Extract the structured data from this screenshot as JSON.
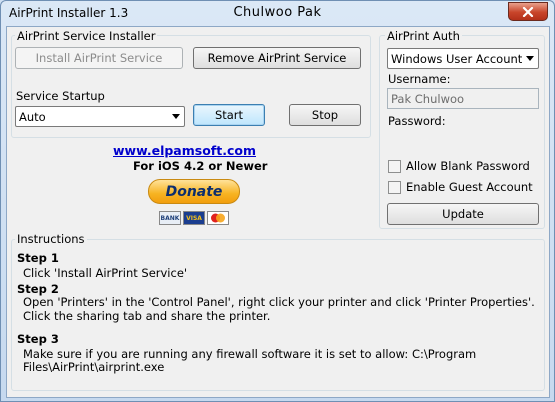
{
  "window": {
    "app_title": "AirPrint Installer 1.3",
    "center_title": "Chulwoo Pak"
  },
  "service_group": {
    "label": "AirPrint Service Installer",
    "install_label": "Install AirPrint Service",
    "remove_label": "Remove AirPrint Service",
    "startup_label": "Service Startup",
    "startup_value": "Auto",
    "start_label": "Start",
    "stop_label": "Stop"
  },
  "promo": {
    "link": "www.elpamsoft.com",
    "subtitle": "For iOS 4.2 or Newer",
    "donate_label": "Donate",
    "cards": [
      "BANK",
      "VISA",
      "MC"
    ]
  },
  "auth_group": {
    "label": "AirPrint Auth",
    "mode_value": "Windows User Account",
    "username_label": "Username:",
    "username_value": "Pak Chulwoo",
    "password_label": "Password:",
    "allow_blank_label": "Allow Blank Password",
    "enable_guest_label": "Enable Guest Account",
    "update_label": "Update"
  },
  "instructions": {
    "label": "Instructions",
    "step1_title": "Step 1",
    "step1_line1": "Click 'Install AirPrint Service'",
    "step2_title": "Step 2",
    "step2_line1": "Open 'Printers' in the 'Control Panel', right click your printer and click 'Printer Properties'.",
    "step2_line2": "Click the sharing tab and share the printer.",
    "step3_title": "Step 3",
    "step3_line1": "Make sure if you are running any firewall software it is set to allow: C:\\Program",
    "step3_line2": "Files\\AirPrint\\airprint.exe"
  },
  "colors": {
    "link": "#0000cc",
    "close": "#c8452a",
    "donate": "#f7b321"
  }
}
